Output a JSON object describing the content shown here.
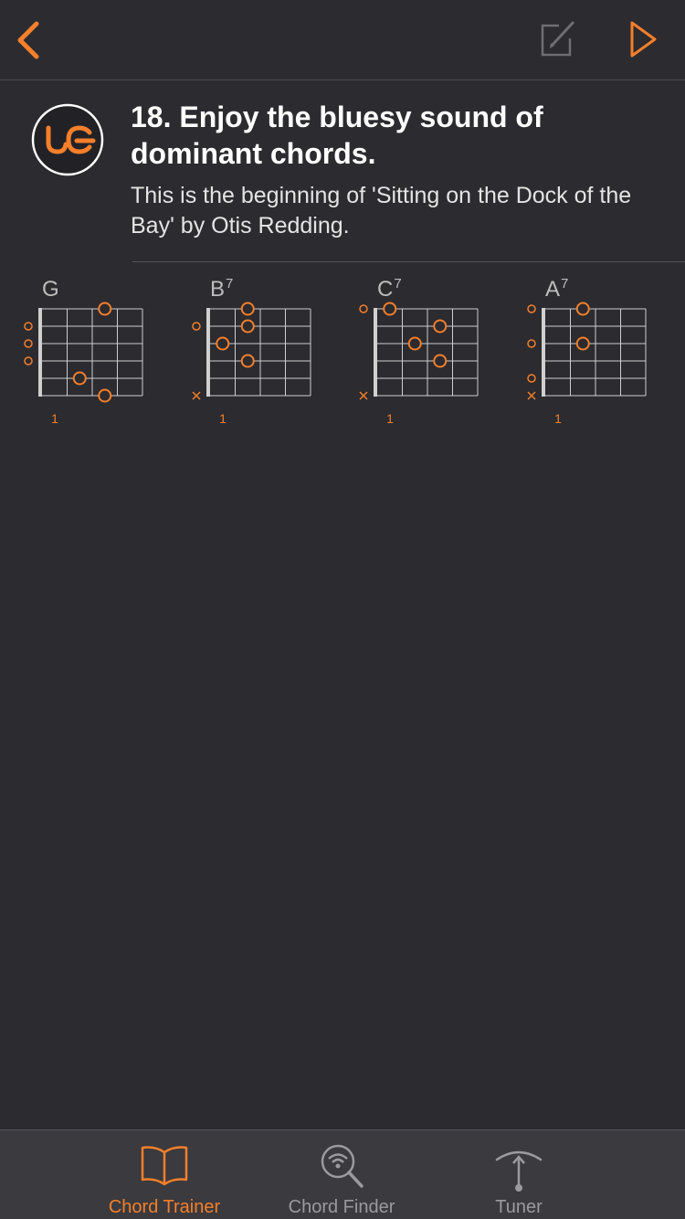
{
  "colors": {
    "accent": "#f57f2a",
    "background": "#2b2b30",
    "tabbar": "#3a3a3f",
    "muted": "#9a9a9f"
  },
  "topbar": {
    "back_icon": "chevron-left-icon",
    "edit_icon": "edit-icon",
    "play_icon": "play-icon"
  },
  "lesson": {
    "logo_text": "UG",
    "title": "18. Enjoy the bluesy sound of dominant chords.",
    "description": "This is the beginning of 'Sitting on the Dock of the Bay' by Otis Redding."
  },
  "chords": [
    {
      "root": "G",
      "suffix": "",
      "fret_label": "1",
      "strings": [
        "",
        "o",
        "o",
        "o",
        "",
        ""
      ],
      "dots": [
        [
          1,
          3
        ],
        [
          5,
          2
        ],
        [
          6,
          3
        ]
      ]
    },
    {
      "root": "B",
      "suffix": "7",
      "fret_label": "1",
      "strings": [
        "",
        "o",
        "",
        "",
        "",
        "x"
      ],
      "dots": [
        [
          1,
          2
        ],
        [
          2,
          2
        ],
        [
          3,
          1
        ],
        [
          4,
          2
        ]
      ]
    },
    {
      "root": "C",
      "suffix": "7",
      "fret_label": "1",
      "strings": [
        "o",
        "",
        "",
        "",
        "",
        "x"
      ],
      "dots": [
        [
          1,
          1
        ],
        [
          2,
          3
        ],
        [
          3,
          2
        ],
        [
          4,
          3
        ]
      ]
    },
    {
      "root": "A",
      "suffix": "7",
      "fret_label": "1",
      "strings": [
        "o",
        "",
        "o",
        "",
        "o",
        "x"
      ],
      "dots": [
        [
          1,
          2
        ],
        [
          3,
          2
        ]
      ]
    }
  ],
  "tabs": [
    {
      "label": "Chord Trainer",
      "icon": "book-icon",
      "active": true
    },
    {
      "label": "Chord Finder",
      "icon": "chord-finder-icon",
      "active": false
    },
    {
      "label": "Tuner",
      "icon": "tuner-icon",
      "active": false
    }
  ]
}
